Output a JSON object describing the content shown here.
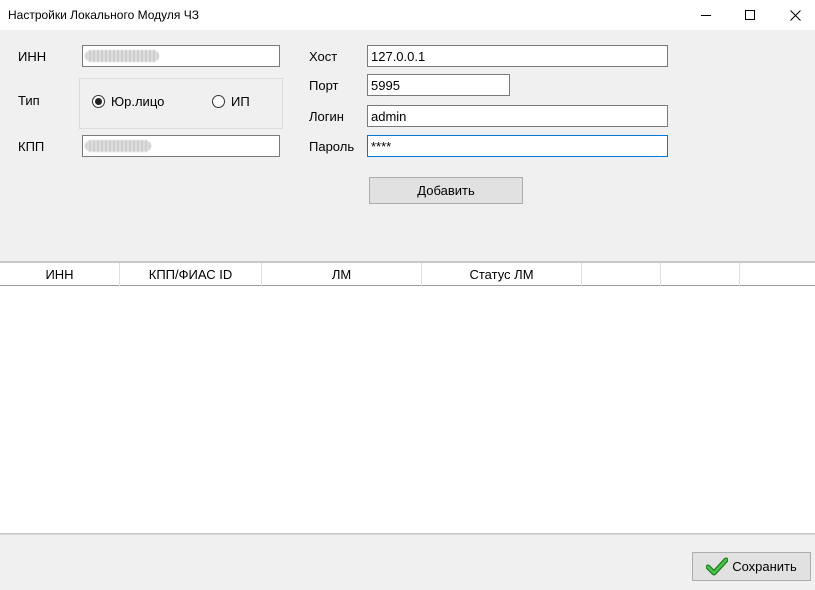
{
  "window": {
    "title": "Настройки Локального Модуля ЧЗ"
  },
  "form": {
    "inn_label": "ИНН",
    "inn_value": "",
    "type_label": "Тип",
    "type_options": [
      "Юр.лицо",
      "ИП"
    ],
    "type_selected": "Юр.лицо",
    "kpp_label": "КПП",
    "kpp_value": "",
    "host_label": "Хост",
    "host_value": "127.0.0.1",
    "port_label": "Порт",
    "port_value": "5995",
    "login_label": "Логин",
    "login_value": "admin",
    "password_label": "Пароль",
    "password_value": "****",
    "add_button": "Добавить"
  },
  "table": {
    "columns": [
      "ИНН",
      "КПП/ФИАС ID",
      "ЛМ",
      "Статус ЛМ",
      "",
      "",
      ""
    ],
    "rows": []
  },
  "footer": {
    "save_button": "Сохранить"
  },
  "colors": {
    "focus_border": "#0078d7",
    "check_green": "#2fa52f"
  }
}
